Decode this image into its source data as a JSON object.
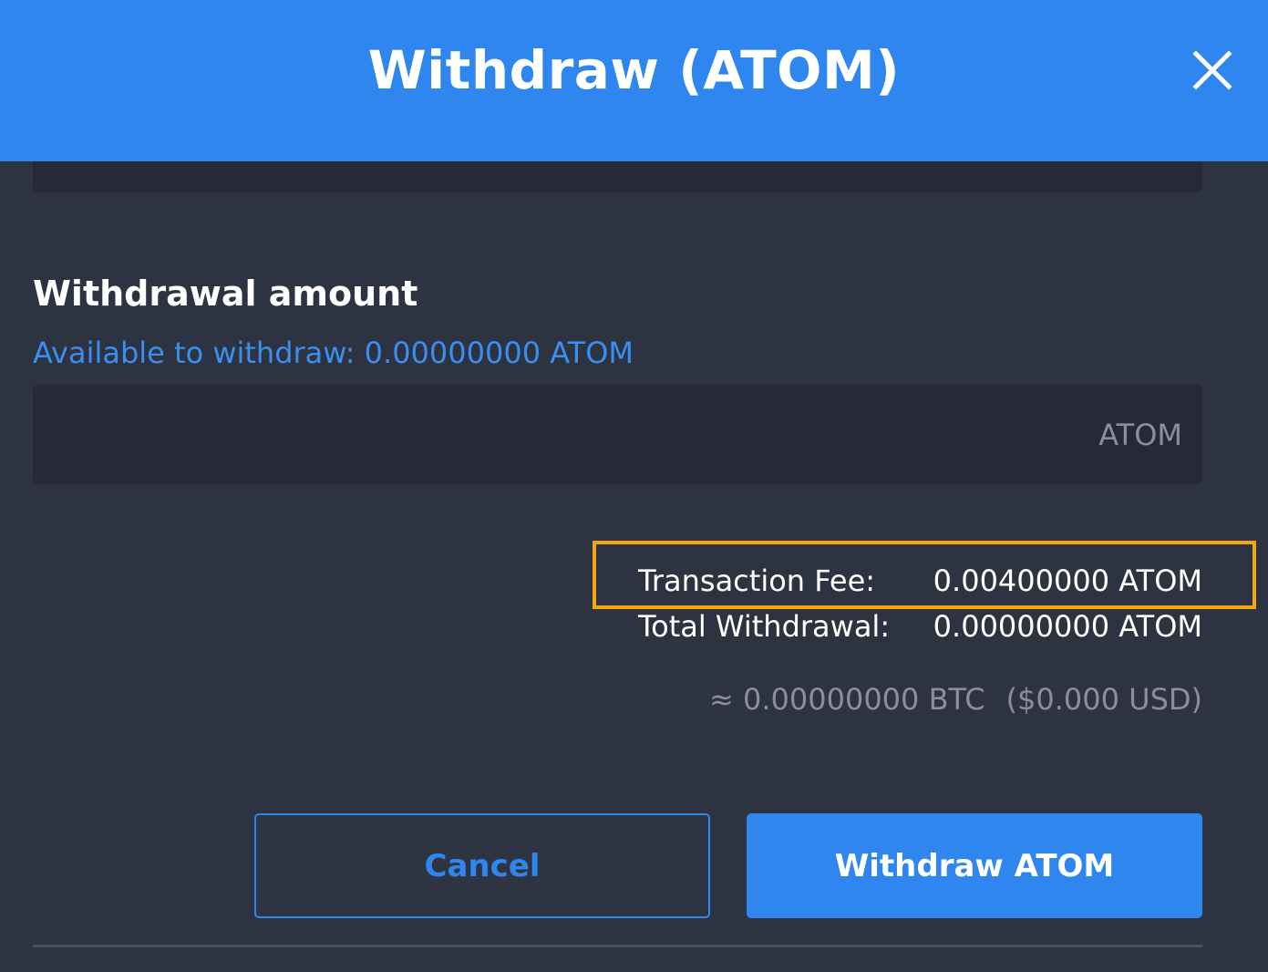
{
  "header": {
    "title": "Withdraw (ATOM)",
    "close_icon": "close-icon"
  },
  "withdrawal": {
    "section_title": "Withdrawal amount",
    "available_text": "Available to withdraw: 0.00000000 ATOM",
    "amount_value": "",
    "amount_unit": "ATOM"
  },
  "summary": {
    "fee_label": "Transaction Fee:",
    "fee_value": "0.00400000 ATOM",
    "total_label": "Total Withdrawal:",
    "total_value": "0.00000000 ATOM",
    "btc_equivalent": "≈ 0.00000000 BTC",
    "usd_equivalent": "($0.000 USD)"
  },
  "actions": {
    "cancel_label": "Cancel",
    "withdraw_label": "Withdraw ATOM"
  },
  "colors": {
    "accent": "#2e86ee",
    "background": "#2e3342",
    "field_background": "#252a36",
    "highlight": "#f3a712",
    "muted_text": "#8b8f99"
  }
}
